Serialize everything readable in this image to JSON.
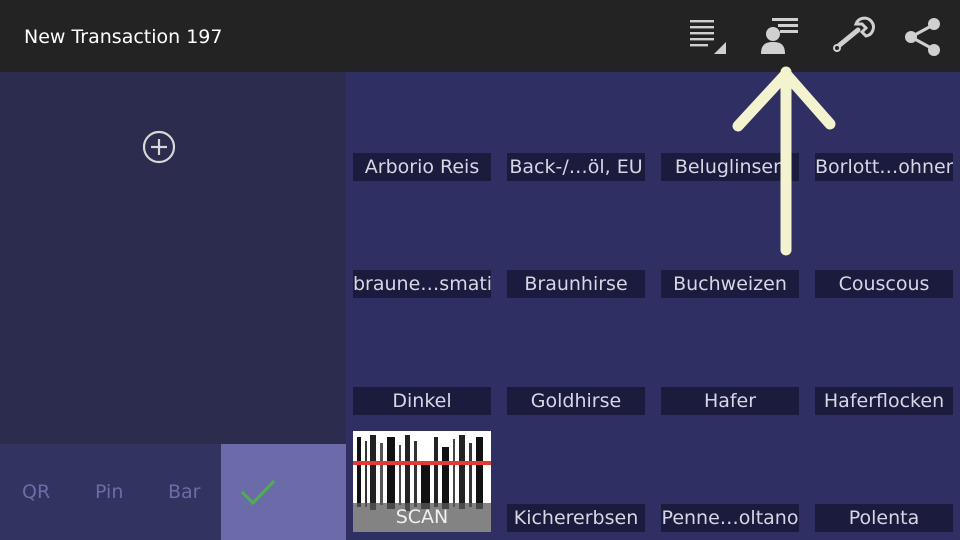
{
  "header": {
    "title": "New Transaction 197",
    "icons": [
      "list-filter-icon",
      "contact-list-icon",
      "wrench-icon",
      "share-icon"
    ]
  },
  "left_panel": {
    "add_icon": "add-circle-icon"
  },
  "bottom_bar": {
    "qr_label": "QR",
    "pin_label": "Pin",
    "bar_label": "Bar",
    "confirm_icon": "checkmark-icon",
    "accent_color": "#6b6ba9"
  },
  "products": [
    "Arborio Reis",
    "Back-/…öl, EU",
    "Beluglinsen",
    "Borlott…ohnen",
    "braune…smati",
    "Braunhirse",
    "Buchweizen",
    "Couscous",
    "Dinkel",
    "Goldhirse",
    "Hafer",
    "Haferflocken",
    "Kichererbsen",
    "Penne…oltano",
    "Polenta"
  ],
  "scan": {
    "label": "SCAN",
    "icon": "barcode-scan-icon"
  },
  "overlay": {
    "icon": "arrow-up-annotation-icon"
  }
}
